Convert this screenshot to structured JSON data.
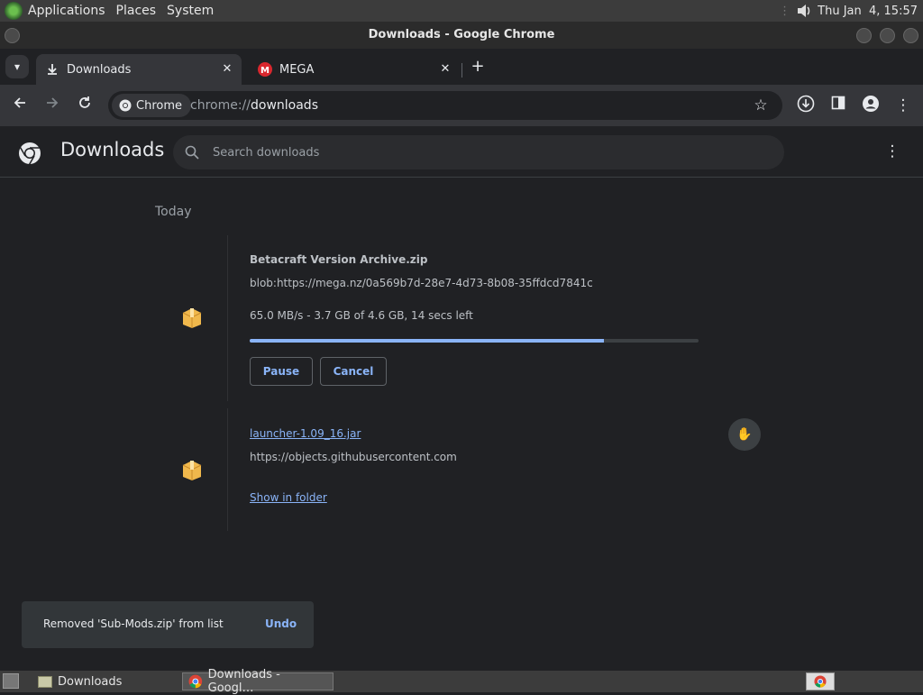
{
  "top_panel": {
    "menus": [
      "Applications",
      "Places",
      "System"
    ],
    "clock": "Thu Jan  4, 15:57"
  },
  "window": {
    "title": "Downloads - Google Chrome"
  },
  "tabs": [
    {
      "label": "Downloads",
      "active": true
    },
    {
      "label": "MEGA",
      "active": false
    }
  ],
  "toolbar": {
    "chip_label": "Chrome",
    "url_scheme": "chrome://",
    "url_path": "downloads"
  },
  "downloads_page": {
    "title": "Downloads",
    "search_placeholder": "Search downloads",
    "day_heading": "Today",
    "items": [
      {
        "name": "Betacraft Version Archive.zip",
        "url": "blob:https://mega.nz/0a569b7d-28e7-4d73-8b08-35ffdcd7841c",
        "status": "65.0 MB/s - 3.7 GB of 4.6 GB, 14 secs left",
        "progress": 0.79,
        "actions": [
          "Pause",
          "Cancel"
        ]
      },
      {
        "name": "launcher-1.09_16.jar",
        "url": "https://objects.githubusercontent.com",
        "link": "Show in folder"
      }
    ]
  },
  "toast": {
    "message": "Removed 'Sub-Mods.zip' from list",
    "action": "Undo"
  },
  "taskbar": {
    "items": [
      {
        "label": "Downloads",
        "icon": "folder-icon"
      },
      {
        "label": "Downloads - Googl…",
        "icon": "chrome-icon"
      }
    ]
  },
  "colors": {
    "accent": "#8ab4f8",
    "page_bg": "#202124",
    "toolbar_bg": "#35363a"
  }
}
